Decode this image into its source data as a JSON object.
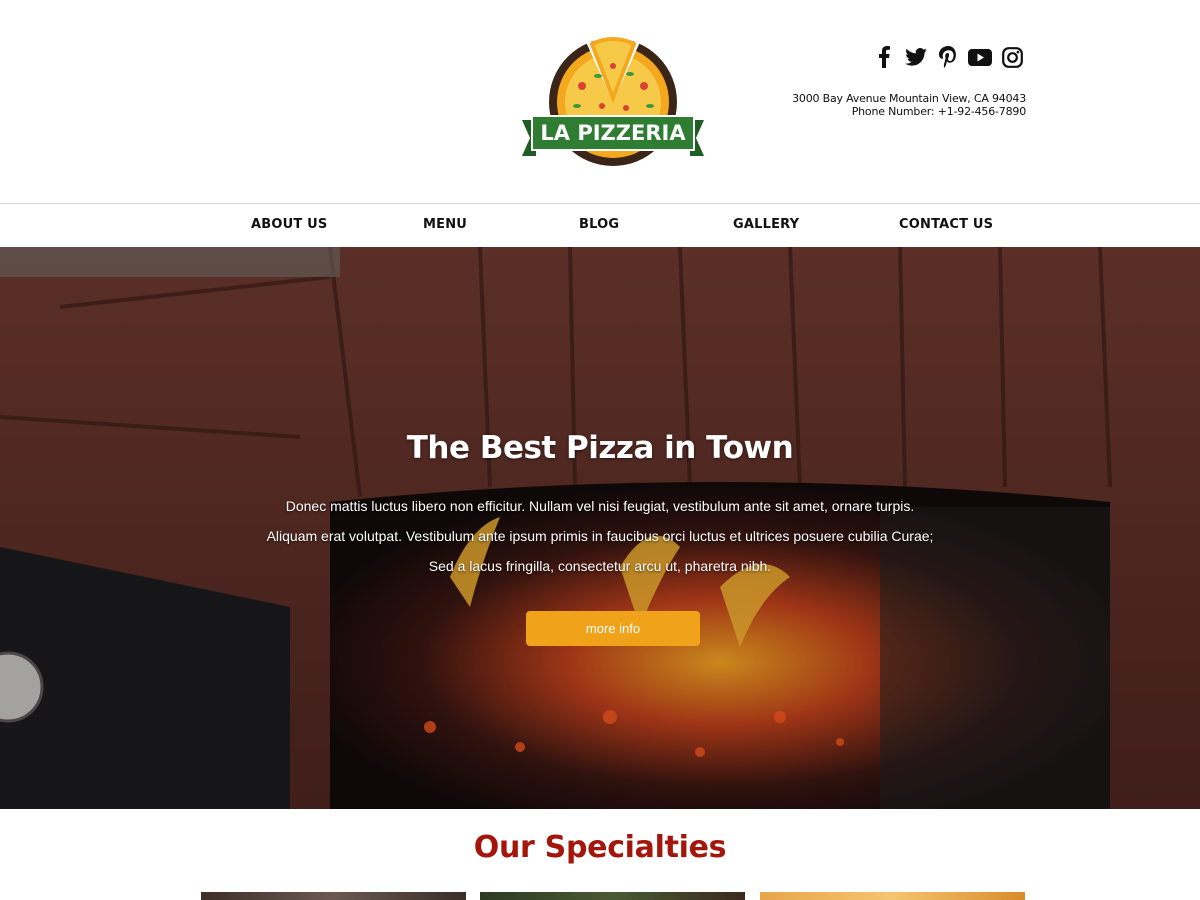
{
  "header": {
    "logo_text": "LA PIZZERIA",
    "social": [
      "facebook-icon",
      "twitter-icon",
      "pinterest-icon",
      "youtube-icon",
      "instagram-icon"
    ],
    "address_line": "3000 Bay Avenue Mountain View, CA 94043",
    "phone_line": "Phone Number: +1-92-456-7890"
  },
  "nav": {
    "items": [
      {
        "label": "ABOUT US"
      },
      {
        "label": "MENU"
      },
      {
        "label": "BLOG"
      },
      {
        "label": "GALLERY"
      },
      {
        "label": "CONTACT US"
      }
    ]
  },
  "hero": {
    "title": "The Best Pizza in Town",
    "lines": [
      "Donec mattis luctus libero non efficitur. Nullam vel nisi feugiat, vestibulum ante sit amet, ornare turpis.",
      "Aliquam erat volutpat. Vestibulum ante ipsum primis in faucibus orci luctus et ultrices posuere cubilia Curae;",
      "Sed a lacus fringilla, consectetur arcu ut, pharetra nibh."
    ],
    "button_label": "more info"
  },
  "specialties": {
    "title": "Our Specialties"
  },
  "colors": {
    "accent": "#f0a21b",
    "title_red": "#a4160b",
    "logo_green": "#2e7d32"
  }
}
